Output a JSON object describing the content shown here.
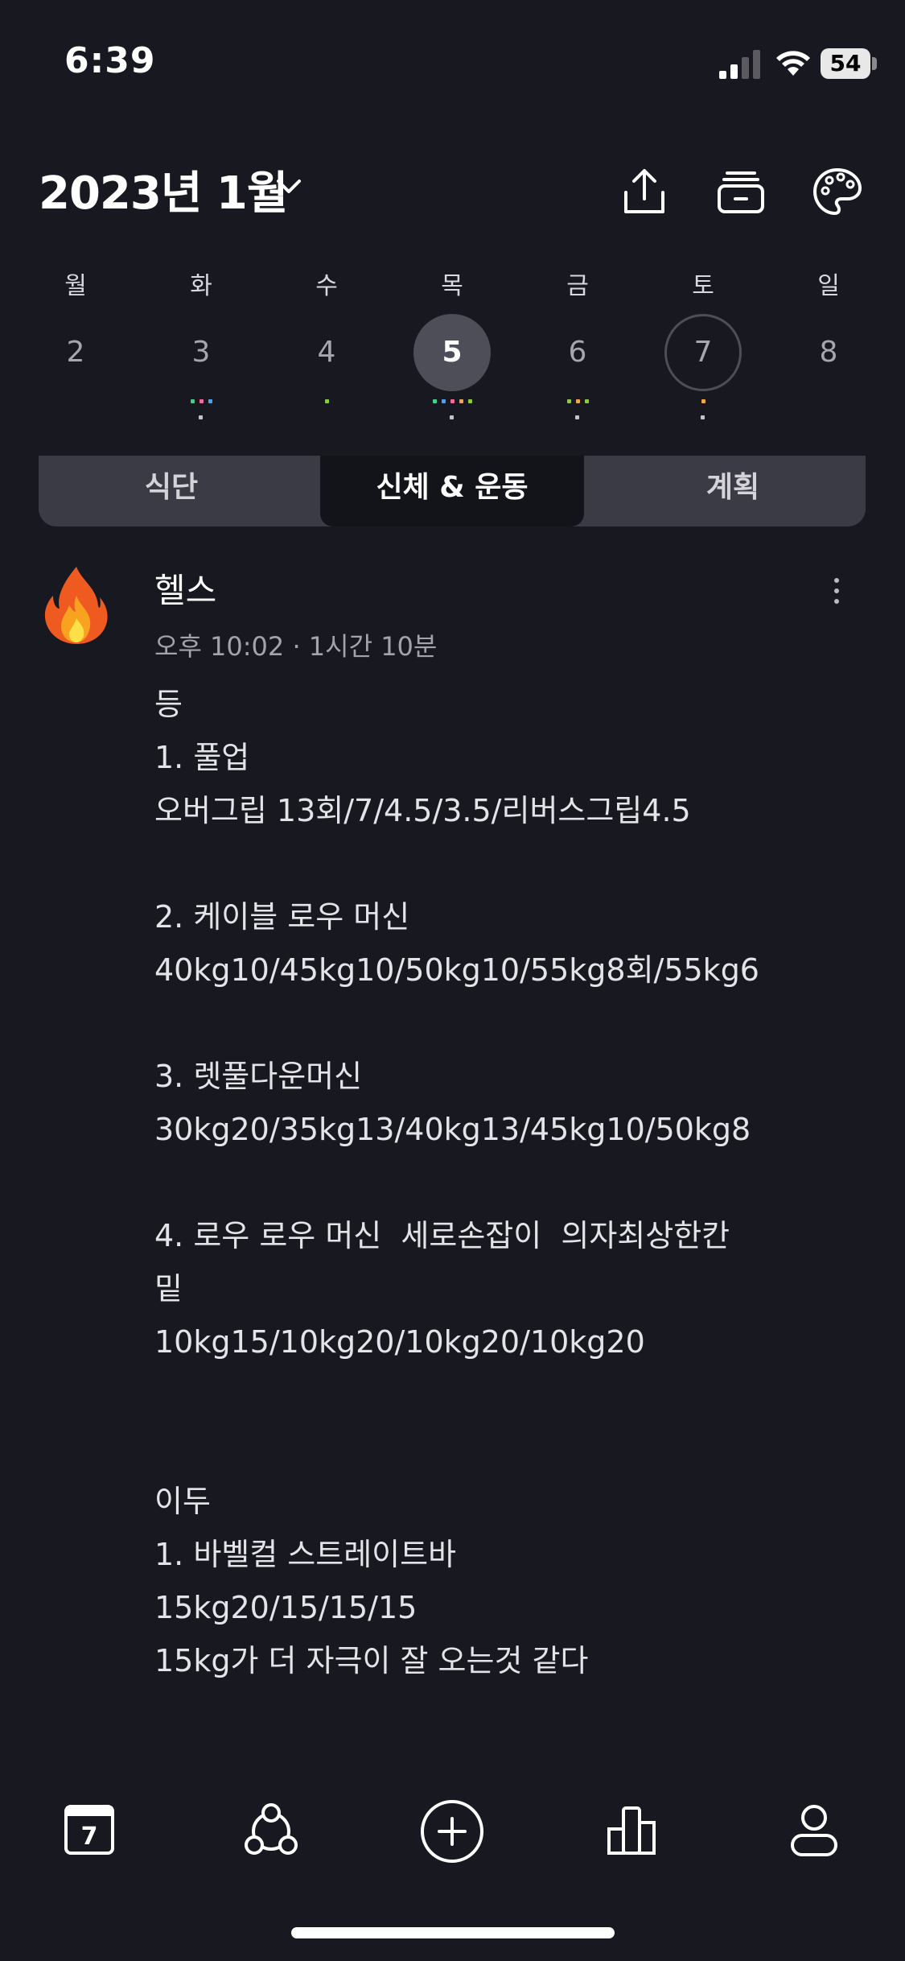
{
  "status_bar": {
    "time": "6:39",
    "battery": "54"
  },
  "header": {
    "title": "2023년 1월"
  },
  "week": {
    "days": [
      {
        "name": "월",
        "num": "2",
        "selected": false,
        "today": false,
        "dots": []
      },
      {
        "name": "화",
        "num": "3",
        "selected": false,
        "today": false,
        "dots": [
          "#3fcf8e",
          "#f06b9c",
          "#4aa3f0"
        ]
      },
      {
        "name": "수",
        "num": "4",
        "selected": false,
        "today": false,
        "dots": [
          "#8ccc3a"
        ]
      },
      {
        "name": "목",
        "num": "5",
        "selected": true,
        "today": false,
        "dots": [
          "#3fcf8e",
          "#4aa3f0",
          "#f06b9c",
          "#f0a64a",
          "#8ccc3a"
        ]
      },
      {
        "name": "금",
        "num": "6",
        "selected": false,
        "today": false,
        "dots": [
          "#8ccc3a",
          "#f0a64a",
          "#8ccc3a"
        ]
      },
      {
        "name": "토",
        "num": "7",
        "selected": false,
        "today": true,
        "dots": [
          "#f0a64a"
        ]
      },
      {
        "name": "일",
        "num": "8",
        "selected": false,
        "today": false,
        "dots": []
      }
    ]
  },
  "tabs": [
    {
      "label": "식단"
    },
    {
      "label": "신체 & 운동"
    },
    {
      "label": "계획"
    }
  ],
  "entry": {
    "icon": "fire-icon",
    "title": "헬스",
    "meta": "오후 10:02 · 1시간 10분",
    "lines": [
      "등",
      "1. 풀업",
      "오버그립 13회/7/4.5/3.5/리버스그립4.5",
      "",
      "2. 케이블 로우 머신",
      "40kg10/45kg10/50kg10/55kg8회/55kg6",
      "",
      "3. 렛풀다운머신",
      "30kg20/35kg13/40kg13/45kg10/50kg8",
      "",
      "4. 로우 로우 머신  세로손잡이  의자최상한칸",
      "밑",
      "10kg15/10kg20/10kg20/10kg20",
      "",
      "",
      "이두",
      "1. 바벨컬 스트레이트바",
      "15kg20/15/15/15",
      "15kg가 더 자극이 잘 오는것 같다"
    ]
  },
  "bottom_nav": {
    "calendar_day": "7"
  }
}
